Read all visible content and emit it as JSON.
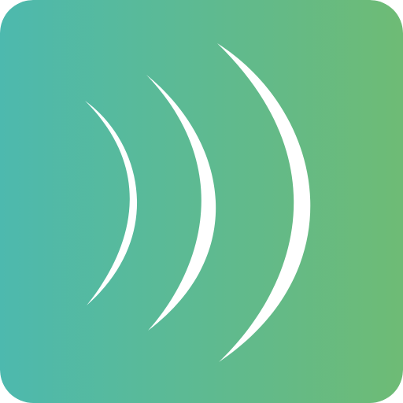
{
  "icon": {
    "name": "sound-waves-icon",
    "gradient_start": "#4DB9AE",
    "gradient_end": "#6EBB75",
    "wave_color": "#FFFFFF",
    "wave_count": 3
  }
}
